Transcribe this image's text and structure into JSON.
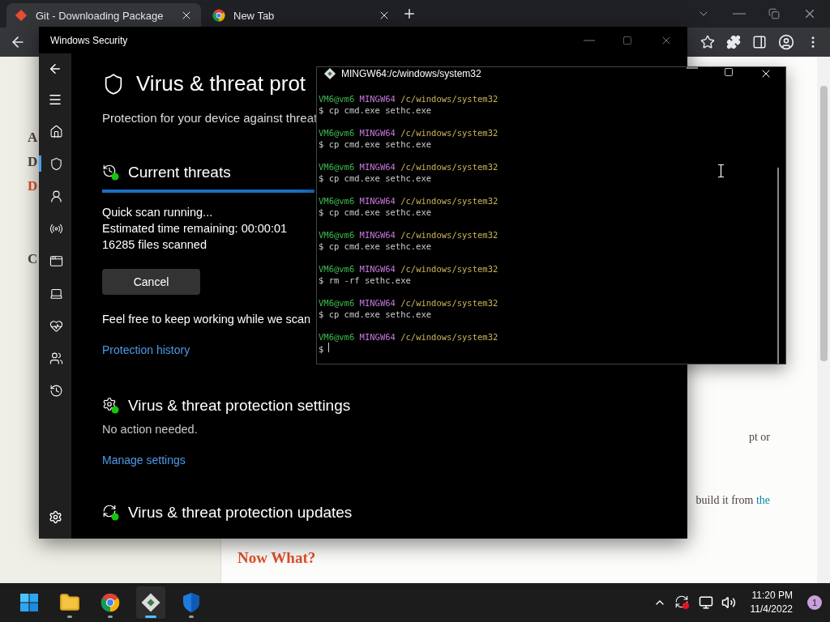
{
  "browser": {
    "tabs": [
      {
        "title": "Git - Downloading Package",
        "selected": true,
        "kind": "git"
      },
      {
        "title": "New Tab",
        "selected": false,
        "kind": "chrome"
      }
    ],
    "page": {
      "left_fragments": [
        {
          "text": "A",
          "kind": "plain"
        },
        {
          "text": "D",
          "kind": "plain"
        },
        {
          "text": "D",
          "kind": "accent"
        },
        {
          "text": "C",
          "kind": "plain"
        }
      ],
      "right_text_1": "pt or",
      "right_text_2": "build it from",
      "right_link": "the",
      "heading": "Now What?"
    }
  },
  "security_window": {
    "title": "Windows Security",
    "nav": [
      {
        "kind": "home",
        "selected": false
      },
      {
        "kind": "shield",
        "selected": true
      },
      {
        "kind": "account",
        "selected": false
      },
      {
        "kind": "network",
        "selected": false
      },
      {
        "kind": "app",
        "selected": false
      },
      {
        "kind": "device",
        "selected": false
      },
      {
        "kind": "health",
        "selected": false
      },
      {
        "kind": "family",
        "selected": false
      },
      {
        "kind": "history",
        "selected": false
      }
    ],
    "heading": "Virus & threat prot",
    "subtitle": "Protection for your device against threat",
    "current_threats": {
      "title": "Current threats",
      "level": 1,
      "status": "Quick scan running...",
      "eta": "Estimated time remaining:  00:00:01",
      "files": "16285  files scanned",
      "cancel": "Cancel",
      "note": "Feel free to keep working while we scan",
      "link": "Protection history"
    },
    "settings": {
      "title": "Virus & threat protection settings",
      "status": "No action needed.",
      "link": "Manage settings"
    },
    "updates": {
      "title": "Virus & threat protection updates"
    }
  },
  "terminal": {
    "title": "MINGW64:/c/windows/system32",
    "lines": [
      {
        "kind": "prompt",
        "user": "VM6@vm6",
        "system": "MINGW64",
        "path": "/c/windows/system32"
      },
      {
        "kind": "command",
        "text": "$ cp cmd.exe sethc.exe"
      },
      {
        "kind": "prompt",
        "user": "VM6@vm6",
        "system": "MINGW64",
        "path": "/c/windows/system32"
      },
      {
        "kind": "command",
        "text": "$ cp cmd.exe sethc.exe"
      },
      {
        "kind": "prompt",
        "user": "VM6@vm6",
        "system": "MINGW64",
        "path": "/c/windows/system32"
      },
      {
        "kind": "command",
        "text": "$ cp cmd.exe sethc.exe"
      },
      {
        "kind": "prompt",
        "user": "VM6@vm6",
        "system": "MINGW64",
        "path": "/c/windows/system32"
      },
      {
        "kind": "command",
        "text": "$ cp cmd.exe sethc.exe"
      },
      {
        "kind": "prompt",
        "user": "VM6@vm6",
        "system": "MINGW64",
        "path": "/c/windows/system32"
      },
      {
        "kind": "command",
        "text": "$ cp cmd.exe sethc.exe"
      },
      {
        "kind": "prompt",
        "user": "VM6@vm6",
        "system": "MINGW64",
        "path": "/c/windows/system32"
      },
      {
        "kind": "command",
        "text": "$ rm -rf sethc.exe"
      },
      {
        "kind": "prompt",
        "user": "VM6@vm6",
        "system": "MINGW64",
        "path": "/c/windows/system32"
      },
      {
        "kind": "command",
        "text": "$ cp cmd.exe sethc.exe"
      },
      {
        "kind": "prompt",
        "user": "VM6@vm6",
        "system": "MINGW64",
        "path": "/c/windows/system32"
      },
      {
        "kind": "input",
        "text": "$"
      }
    ]
  },
  "taskbar": {
    "apps": [
      {
        "kind": "start",
        "selected": false
      },
      {
        "kind": "files",
        "selected": false
      },
      {
        "kind": "chrome",
        "selected": false
      },
      {
        "kind": "git",
        "selected": true
      },
      {
        "kind": "defender",
        "selected": false
      }
    ],
    "time": "11:20 PM",
    "date": "11/4/2022",
    "notifications": "1"
  }
}
